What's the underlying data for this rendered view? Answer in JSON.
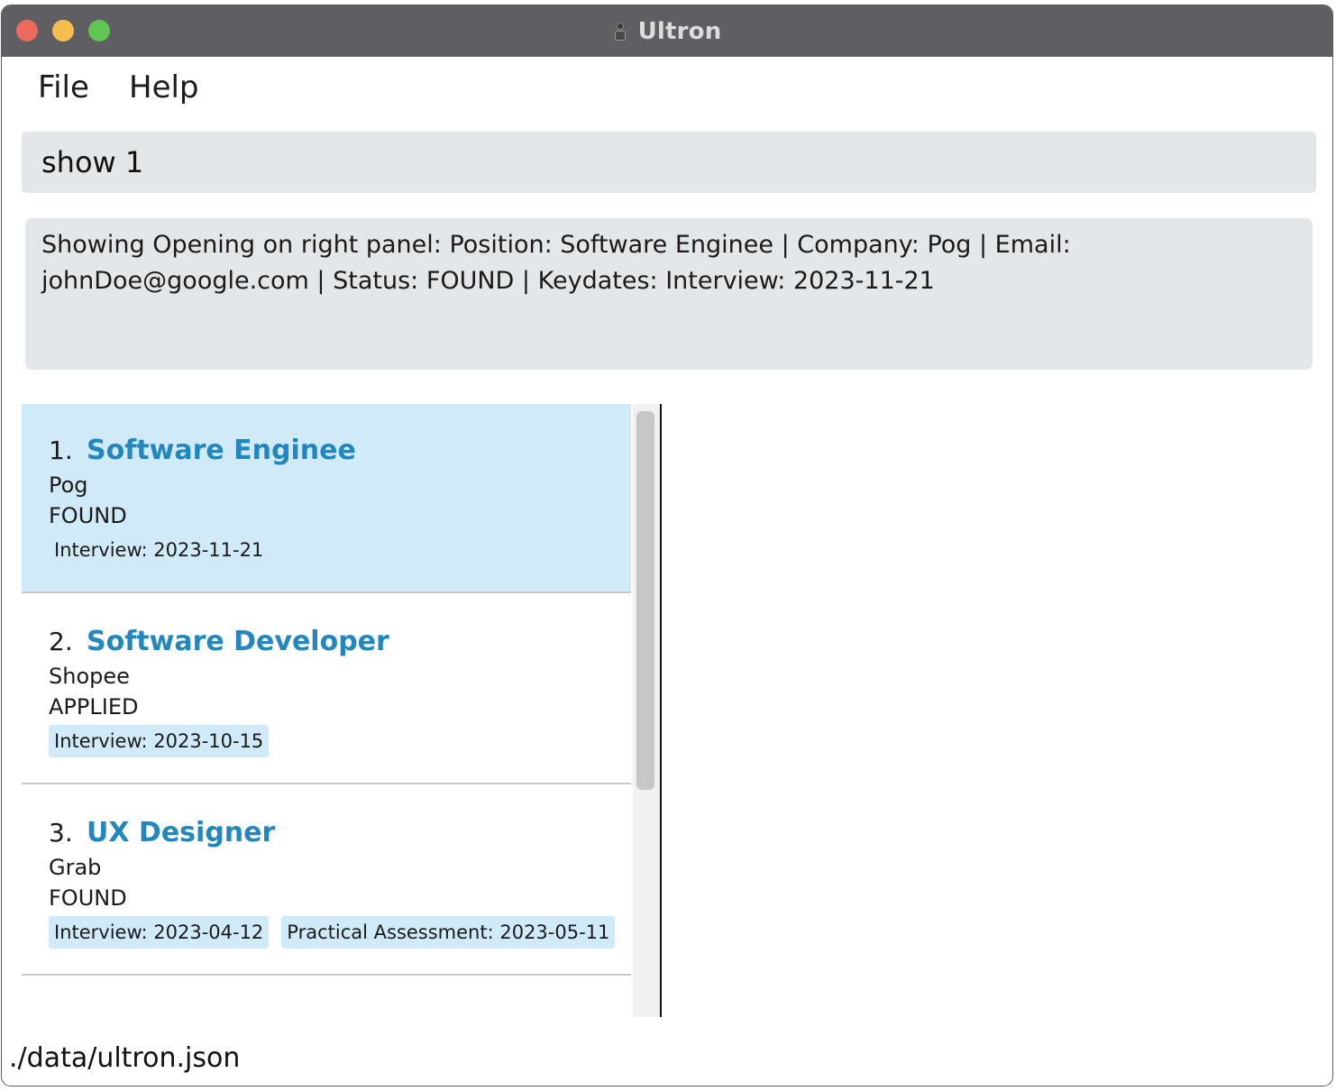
{
  "window": {
    "title": "Ultron"
  },
  "menu": {
    "file": "File",
    "help": "Help"
  },
  "command": {
    "value": "show 1"
  },
  "result": {
    "text": "Showing Opening on right panel: Position: Software Enginee | Company: Pog | Email: johnDoe@google.com | Status: FOUND | Keydates: Interview: 2023-11-21"
  },
  "openings": [
    {
      "index": "1.",
      "position": "Software Enginee",
      "company": "Pog",
      "status": "FOUND",
      "keydates": [
        " Interview: 2023-11-21"
      ],
      "selected": true
    },
    {
      "index": "2.",
      "position": "Software Developer",
      "company": "Shopee",
      "status": "APPLIED",
      "keydates": [
        "Interview: 2023-10-15"
      ],
      "selected": false
    },
    {
      "index": "3.",
      "position": "UX Designer",
      "company": "Grab",
      "status": "FOUND",
      "keydates": [
        "Interview: 2023-04-12",
        "Practical Assessment: 2023-05-11"
      ],
      "selected": false
    }
  ],
  "statusbar": {
    "path": "./data/ultron.json"
  },
  "colors": {
    "accent": "#2286bf",
    "selected_bg": "#d0eaf8",
    "box_bg": "#e4e7ea",
    "titlebar_bg": "#5f5e63"
  },
  "icons": {
    "app": "robot-icon"
  }
}
